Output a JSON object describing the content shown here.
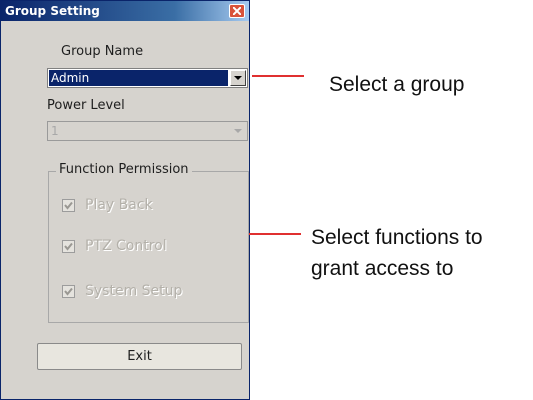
{
  "window": {
    "title": "Group Setting",
    "close_icon": "close-icon"
  },
  "group_name": {
    "label": "Group Name",
    "selected": "Admin"
  },
  "power_level": {
    "label": "Power Level",
    "selected": "1"
  },
  "function_permission": {
    "title": "Function Permission",
    "items": [
      {
        "label": "Play Back",
        "checked": true,
        "enabled": false
      },
      {
        "label": "PTZ Control",
        "checked": true,
        "enabled": false
      },
      {
        "label": "System Setup",
        "checked": true,
        "enabled": false
      }
    ]
  },
  "buttons": {
    "exit": "Exit"
  },
  "annotations": {
    "select_group": "Select a group",
    "select_functions_line1": "Select functions to",
    "select_functions_line2": "grant access to"
  },
  "colors": {
    "title_bar": "#0a246a",
    "selection": "#0a246a",
    "callout_line": "#e03030",
    "window_bg": "#d6d3ce"
  }
}
